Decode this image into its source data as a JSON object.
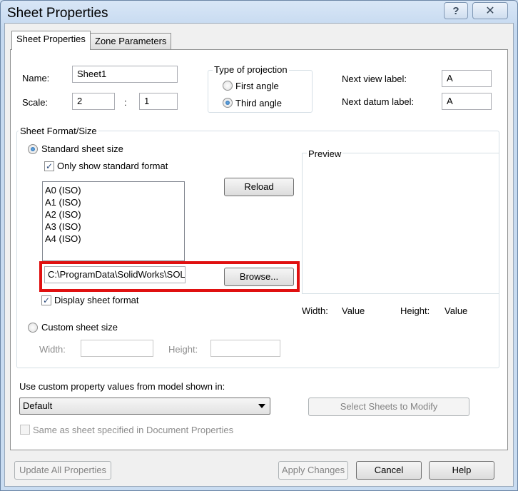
{
  "window": {
    "title": "Sheet Properties",
    "help_glyph": "?",
    "close_glyph": "✕"
  },
  "tabs": [
    {
      "label": "Sheet Properties"
    },
    {
      "label": "Zone Parameters"
    }
  ],
  "fields": {
    "name_label": "Name:",
    "name_value": "Sheet1",
    "scale_label": "Scale:",
    "scale_numerator": "2",
    "scale_separator": ":",
    "scale_denominator": "1",
    "next_view_label": "Next view label:",
    "next_view_value": "A",
    "next_datum_label": "Next datum label:",
    "next_datum_value": "A"
  },
  "projection": {
    "title": "Type of projection",
    "first_angle": "First angle",
    "third_angle": "Third angle",
    "selected": "Third angle"
  },
  "sheet_format": {
    "group_title": "Sheet Format/Size",
    "standard_size_label": "Standard sheet size",
    "only_standard_label": "Only show standard format",
    "only_standard_checked": true,
    "sizes": [
      "A0 (ISO)",
      "A1 (ISO)",
      "A2 (ISO)",
      "A3 (ISO)",
      "A4 (ISO)"
    ],
    "reload_label": "Reload",
    "path_value": "C:\\ProgramData\\SolidWorks\\SOL",
    "browse_label": "Browse...",
    "display_format_label": "Display sheet format",
    "display_format_checked": true,
    "custom_size_label": "Custom sheet size",
    "width_label": "Width:",
    "height_label": "Height:",
    "preview_title": "Preview",
    "preview_width_label": "Width:",
    "preview_width_value": "Value",
    "preview_height_label": "Height:",
    "preview_height_value": "Value",
    "check_glyph": "✓"
  },
  "custom_props": {
    "label": "Use custom property values from model shown in:",
    "selected": "Default",
    "select_sheets_label": "Select Sheets to Modify",
    "same_as_label": "Same as sheet specified in Document Properties"
  },
  "footer": {
    "update_all": "Update All Properties",
    "apply": "Apply Changes",
    "cancel": "Cancel",
    "help": "Help"
  },
  "colors": {
    "highlight_border": "#e01010",
    "radio_selected": "#1c5fa4"
  }
}
